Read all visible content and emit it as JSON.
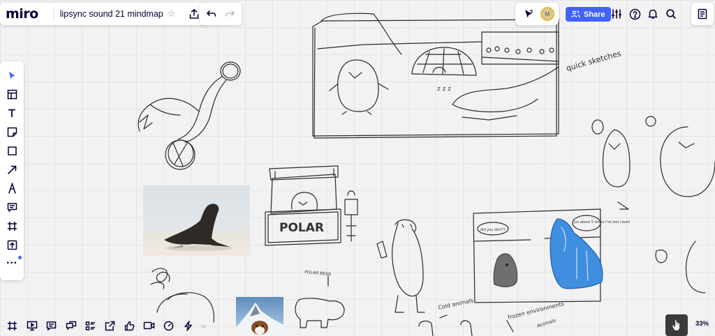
{
  "app": {
    "logo": "miro",
    "board_title": "lipsync sound 21 mindmap"
  },
  "header": {
    "share_label": "Share",
    "avatar_initial": "M"
  },
  "zoom": {
    "level": "33%"
  },
  "sketches": {
    "polar_sign": "POLAR",
    "bubble_left": "did you die???",
    "bubble_right": "jus about 5 times i've lost count",
    "note_quick": "quick sketches",
    "note_polar_bear": "POLAR BEAR",
    "note_cold": "Cold animals",
    "note_frozen": "frozen environments",
    "note_animals": "Animals",
    "note_zzz": "z z z"
  },
  "icons": {
    "left_toolbar": [
      "select-icon",
      "templates-icon",
      "text-icon",
      "sticky-note-icon",
      "shape-icon",
      "arrow-icon",
      "pen-icon",
      "comment-icon",
      "frame-icon",
      "upload-icon",
      "more-icon"
    ],
    "bottom_toolbar": [
      "frames-icon",
      "presentation-icon",
      "comments-icon",
      "chat-icon",
      "cards-icon",
      "share-screen-icon",
      "reactions-icon",
      "video-icon",
      "timer-icon",
      "voting-icon",
      "collapse-icon"
    ],
    "accent": "#4262ff"
  }
}
